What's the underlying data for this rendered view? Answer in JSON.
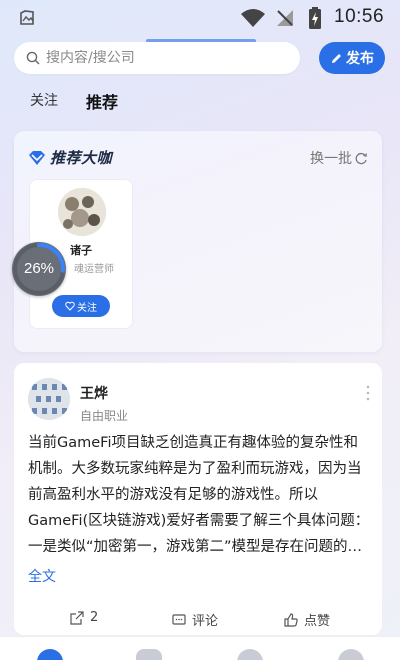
{
  "status_bar": {
    "time": "10:56",
    "icons": [
      "gallery-icon",
      "wifi-icon",
      "no-signal-icon",
      "battery-charging-icon"
    ]
  },
  "search": {
    "placeholder": "搜内容/搜公司",
    "value": ""
  },
  "toolbar": {
    "publish_label": "发布"
  },
  "tabs": [
    {
      "label": "关注",
      "active": false
    },
    {
      "label": "推荐",
      "active": true
    }
  ],
  "recommend_section": {
    "title": "推荐大咖",
    "refresh_label": "换一批",
    "users": [
      {
        "name": "诸子",
        "role": "魂运营师",
        "follow_label": "关注"
      }
    ]
  },
  "overlay": {
    "progress_label": "26%",
    "progress_fraction": 0.26
  },
  "post": {
    "author": "王烨",
    "author_role": "自由职业",
    "body": "当前GameFi项目缺乏创造真正有趣体验的复杂性和机制。大多数玩家纯粹是为了盈利而玩游戏，因为当前高盈利水平的游戏没有足够的游戏性。所以GameFi(区块链游戏)爱好者需要了解三个具体问题：一是类似“加密第一，游戏第二”模型是存在问题的…",
    "full_text_label": "全文",
    "share_count": "2",
    "comment_label": "评论",
    "like_label": "点赞"
  },
  "colors": {
    "accent": "#2a6fe6",
    "background_gradient_start": "#dfe8fb",
    "background_gradient_end": "#eef1f8"
  }
}
